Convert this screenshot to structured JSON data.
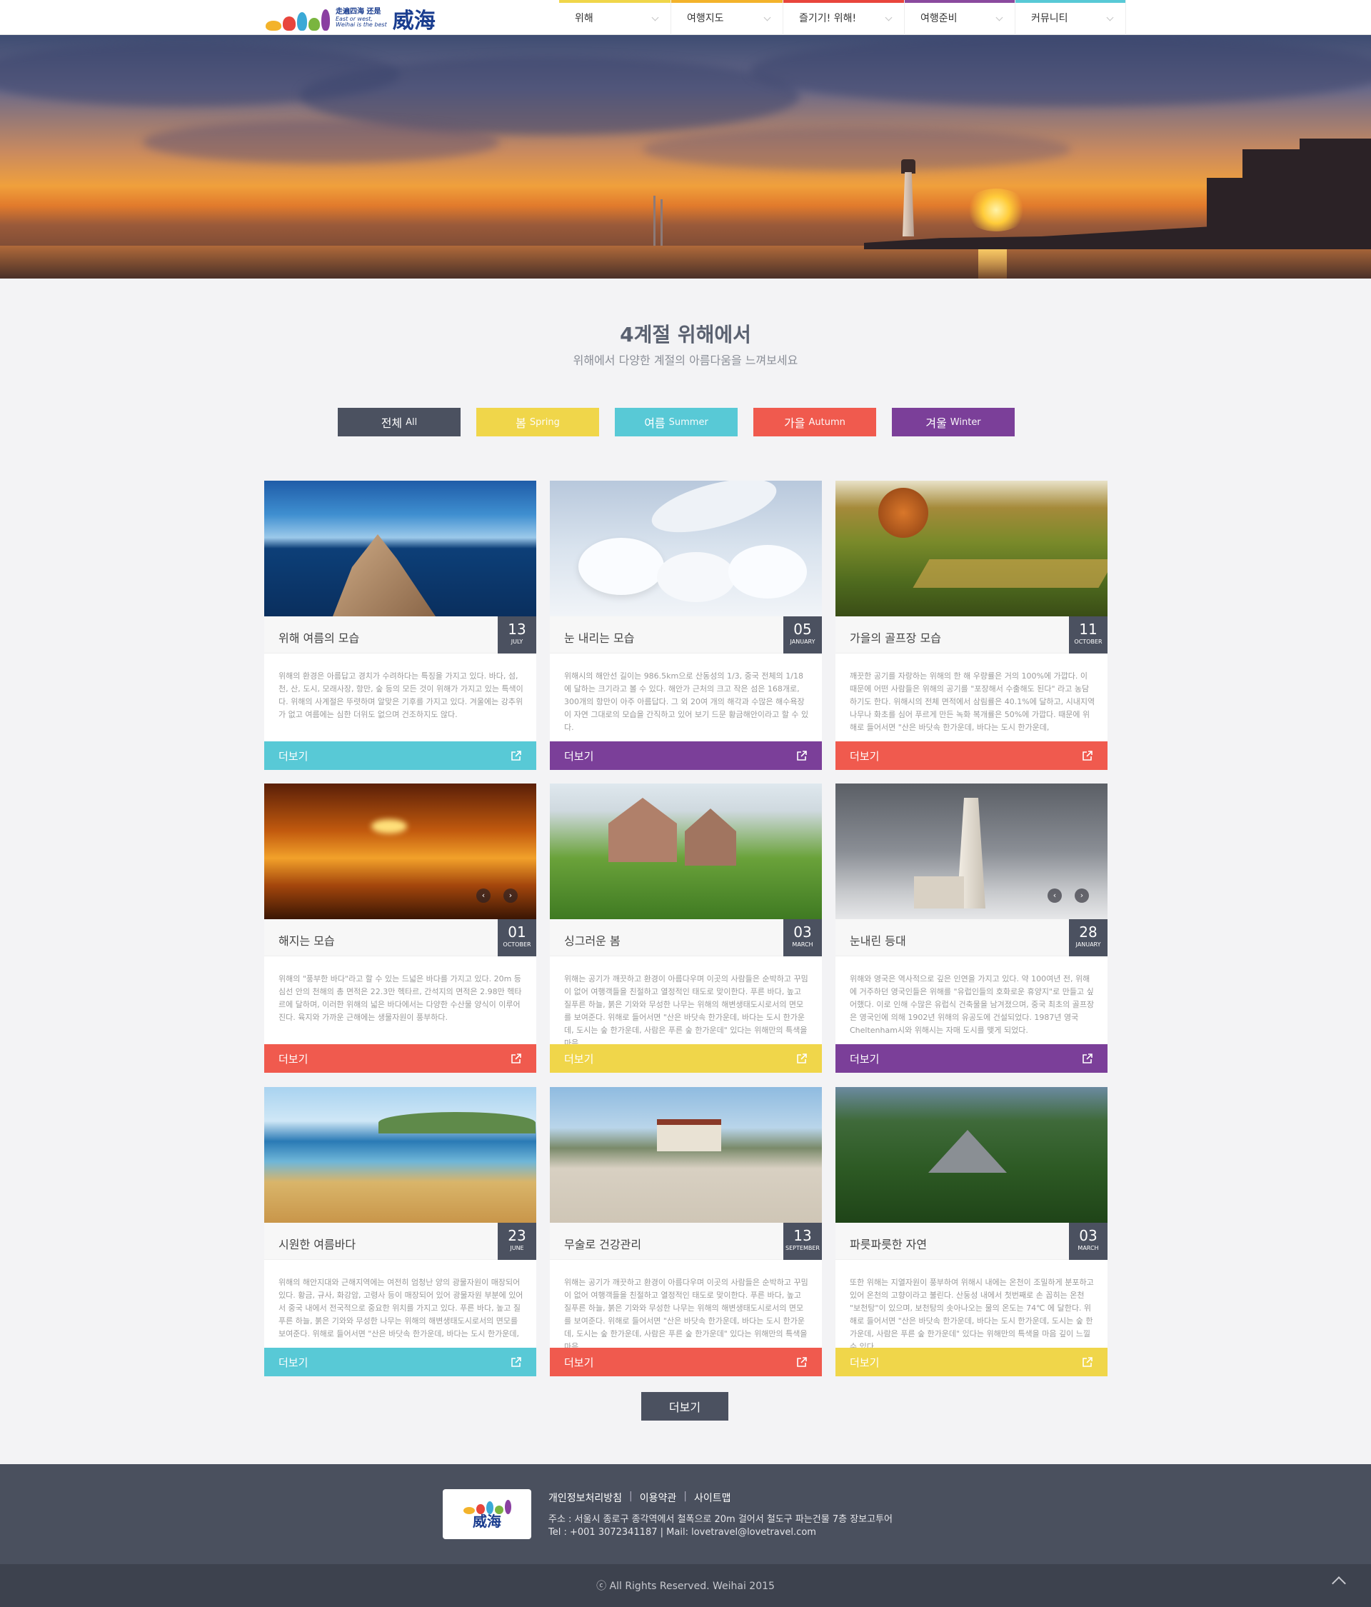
{
  "logo": {
    "cn": "走遍四海 还是",
    "en1": "East or west,",
    "en2": "Weihai is the best",
    "big": "威海"
  },
  "nav": [
    {
      "label": "위해",
      "color": "#f0d64a"
    },
    {
      "label": "여행지도",
      "color": "#f3b32b"
    },
    {
      "label": "즐기기! 위해!",
      "color": "#e8453c"
    },
    {
      "label": "여행준비",
      "color": "#8a4a9e"
    },
    {
      "label": "커뮤니티",
      "color": "#58c9d6"
    }
  ],
  "section": {
    "title": "4계절 위해에서",
    "subtitle": "위해에서 다양한 계절의 아름다움을 느껴보세요"
  },
  "filters": [
    {
      "label": "전체",
      "en": "All",
      "color": "#4b5160"
    },
    {
      "label": "봄",
      "en": "Spring",
      "color": "#f0d64a"
    },
    {
      "label": "여름",
      "en": "Summer",
      "color": "#58c9d6"
    },
    {
      "label": "가을",
      "en": "Autumn",
      "color": "#f05a4e"
    },
    {
      "label": "겨울",
      "en": "Winter",
      "color": "#7b3f99"
    }
  ],
  "cards": [
    {
      "title": "위해 여름의 모습",
      "day": "13",
      "month": "JULY",
      "more": "더보기",
      "accent": "#58c9d6",
      "desc": "위해의 환경은 아름답고 경치가 수려하다는 특징을 가지고 있다. 바다, 섬, 천, 산, 도시, 모래사장, 항만, 숲 등의 모든 것이 위해가 가지고 있는 특색이다. 위해의 사계절은 뚜렷하며 알맞은 기후를 가지고 있다. 겨울에는 강추위가 없고 여름에는 심한 더위도 없으며 건조하지도 않다."
    },
    {
      "title": "눈 내리는 모습",
      "day": "05",
      "month": "JANUARY",
      "more": "더보기",
      "accent": "#7b3f99",
      "desc": "위해시의 해안선 길이는 986.5km으로 산동성의 1/3, 중국 전체의 1/18에 달하는 크기라고 볼 수 있다. 해안가 근처의 크고 작은 섬은 168개로, 300개의 항만이 아주 아름답다. 그 외 20여 개의 해각과 수많은 해수욕장이 자연 그대로의 모습을 간직하고 있어 보기 드문 황금해안이라고 할 수 있다."
    },
    {
      "title": "가을의 골프장 모습",
      "day": "11",
      "month": "OCTOBER",
      "more": "더보기",
      "accent": "#f05a4e",
      "desc": "깨끗한 공기를 자랑하는 위해의 한 해 우량률은 거의 100%에 가깝다. 이 때문에 어떤 사람들은 위해의 공기를 \"포장해서 수출해도 된다\" 라고 농담하기도 한다. 위해시의 전체 면적에서 삼림률은 40.1%에 달하고, 시내지역 나무나 화초를 심어 푸르게 만든 녹화 복개률은 50%에 가깝다. 때문에 위해로 들어서면 \"산은 바닷속 한가운데, 바다는 도시 한가운데,"
    },
    {
      "title": "해지는 모습",
      "day": "01",
      "month": "OCTOBER",
      "more": "더보기",
      "accent": "#f05a4e",
      "desc": "위해의 \"풍부한 바다\"라고 할 수 있는 드넓은 바다를 가지고 있다. 20m 등심선 안의 천해의 총 면적은 22.3만 헥타르, 간석지의 면적은 2.98만 헥타르에 달하며, 이러한 위해의 넓은 바다에서는 다양한 수산물 양식이 이루어진다. 육지와 가까운 근해에는 생물자원이 풍부하다."
    },
    {
      "title": "싱그러운 봄",
      "day": "03",
      "month": "MARCH",
      "more": "더보기",
      "accent": "#f0d64a",
      "desc": "위해는 공기가 깨끗하고 환경이 아름다우며 이곳의 사람들은 순박하고 꾸밈이 없어 여행객들을 친절하고 열정적인 태도로 맞이한다. 푸른 바다, 높고 질푸른 하늘, 붉은 기와와 무성한 나무는 위해의 해변생태도시로서의 면모를 보여준다. 위해로 들어서면 \"산은 바닷속 한가운데, 바다는 도시 한가운데, 도시는 숲 한가운데, 사람은 푸른 숲 한가운데\" 있다는 위해만의 특색을 마음"
    },
    {
      "title": "눈내린 등대",
      "day": "28",
      "month": "JANUARY",
      "more": "더보기",
      "accent": "#7b3f99",
      "desc": "위해와 영국은 역사적으로 깊은 인연을 가지고 있다. 약 100여년 전, 위해에 거주하던 영국인들은 위해를 \"유럽인들의 호화로운 휴양지\"로 만들고 싶어했다. 이로 인해 수많은 유럽식 건축물을 남겨졌으며, 중국 최초의 골프장은 영국인에 의해 1902년 위해의 유공도에 건설되었다. 1987년 영국 Cheltenham시와 위해시는 자매 도시를 맺게 되었다."
    },
    {
      "title": "시원한 여름바다",
      "day": "23",
      "month": "JUNE",
      "more": "더보기",
      "accent": "#58c9d6",
      "desc": "위해의 해안지대와 근해지역에는 여전히 엄청난 양의 광물자원이 매장되어 있다. 황금, 규사, 화강암, 고령사 등이 매장되어 있어 광물자원 부분에 있어서 중국 내에서 전국적으로 중요한 위치를 가지고 있다. 푸른 바다, 높고 질푸른 하늘, 붉은 기와와 무성한 나무는 위해의 해변생태도시로서의 면모를 보여준다. 위해로 들어서면 \"산은 바닷속 한가운데, 바다는 도시 한가운데,"
    },
    {
      "title": "무술로 건강관리",
      "day": "13",
      "month": "SEPTEMBER",
      "more": "더보기",
      "accent": "#f05a4e",
      "desc": "위해는 공기가 깨끗하고 환경이 아름다우며 이곳의 사람들은 순박하고 꾸밈이 없어 여행객들을 친절하고 열정적인 태도로 맞이한다. 푸른 바다, 높고 질푸른 하늘, 붉은 기와와 무성한 나무는 위해의 해변생태도시로서의 면모를 보여준다. 위해로 들어서면 \"산은 바닷속 한가운데, 바다는 도시 한가운데, 도시는 숲 한가운데, 사람은 푸른 숲 한가운데\" 있다는 위해만의 특색을 마음"
    },
    {
      "title": "파릇파릇한 자연",
      "day": "03",
      "month": "MARCH",
      "more": "더보기",
      "accent": "#f0d64a",
      "desc": "또한 위해는 지열자원이 풍부하여 위해시 내에는 온천이 조밀하게 분포하고 있어 온천의 고향이라고 불린다. 산둥성 내에서 첫번째로 손 꼽히는 온천 \"보천탕\"이 있으며, 보천탕의 솟아나오는 물의 온도는 74℃ 에 달한다. 위해로 들어서면 \"산은 바닷속 한가운데, 바다는 도시 한가운데, 도시는 숲 한가운데, 사람은 푸른 숲 한가운데\" 있다는 위해만의 특색을 마음 깊이 느낄 수 있다."
    }
  ],
  "more_button": "더보기",
  "footer": {
    "links": [
      "개인정보처리방침",
      "이용약관",
      "사이트맵"
    ],
    "separator": "|",
    "address": "주소 : 서울시 종로구 종각역에서 철폭으로 20m 걸어서 철도구 파는건물 7층 장보고투어",
    "contact": "Tel : +001 3072341187  |  Mail: lovetravel@lovetravel.com",
    "copyright": "ⓒ  All Rights Reserved. Weihai 2015"
  }
}
